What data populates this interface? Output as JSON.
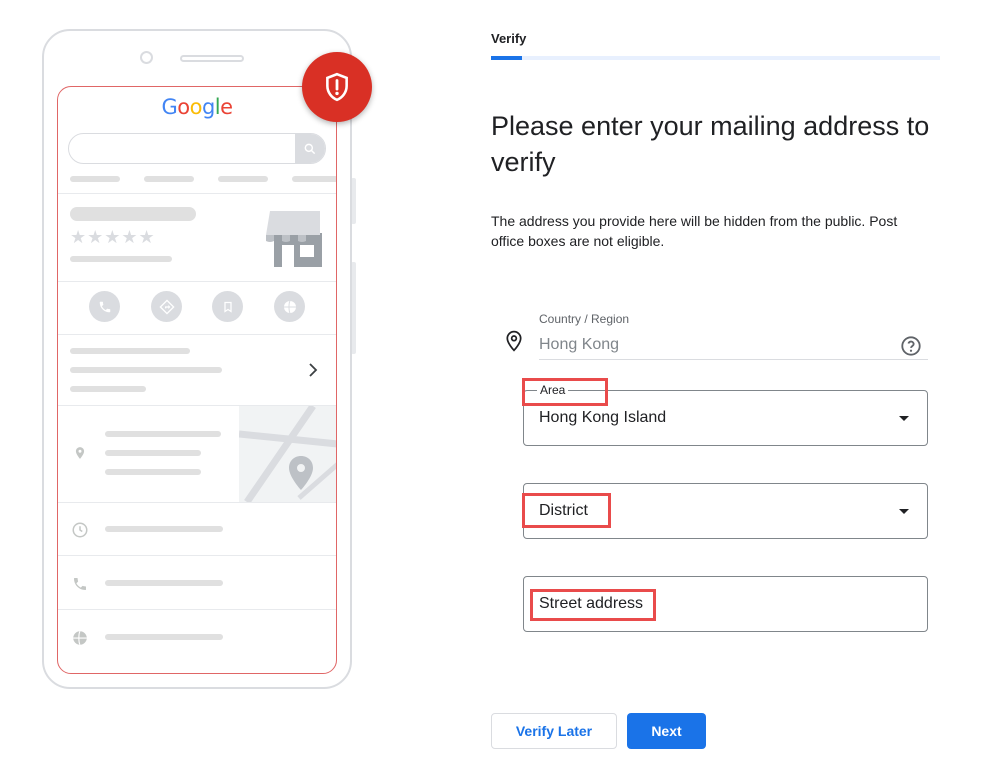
{
  "phone": {
    "logo_letters": [
      "G",
      "o",
      "o",
      "g",
      "l",
      "e"
    ],
    "icons": {
      "search": "search-icon",
      "call": "phone-icon",
      "directions": "directions-icon",
      "save": "bookmark-icon",
      "website": "globe-icon",
      "location": "location-pin-icon",
      "hours": "clock-icon",
      "alert": "shield-alert-icon"
    }
  },
  "progress": {
    "tab_label": "Verify",
    "fraction": 0.07
  },
  "form": {
    "heading": "Please enter your mailing address to verify",
    "description": "The address you provide here will be hidden from the public. Post office boxes are not eligible.",
    "country": {
      "label": "Country / Region",
      "value": "Hong Kong"
    },
    "area": {
      "label": "Area",
      "value": "Hong Kong Island"
    },
    "district": {
      "placeholder": "District"
    },
    "street": {
      "placeholder": "Street address"
    }
  },
  "buttons": {
    "verify_later": "Verify Later",
    "next": "Next"
  },
  "colors": {
    "primary": "#1a73e8",
    "alert": "#d93025",
    "highlight": "#e94b4b"
  }
}
